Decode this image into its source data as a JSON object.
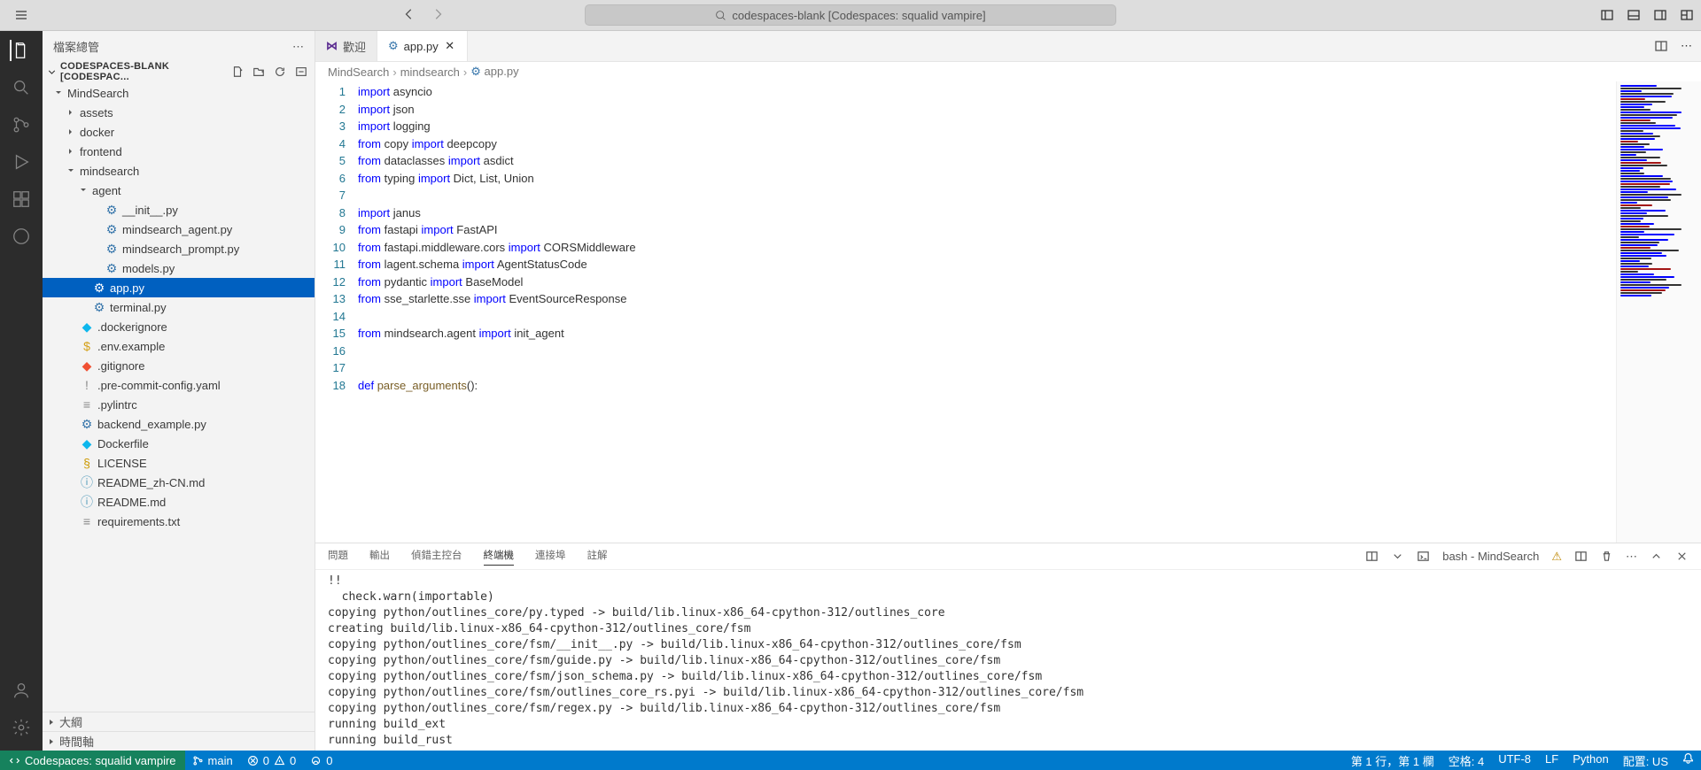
{
  "titlebar": {
    "search_text": "codespaces-blank [Codespaces: squalid vampire]"
  },
  "sidebar": {
    "header": "檔案總管",
    "root": "CODESPACES-BLANK [CODESPAC...",
    "tree": [
      {
        "label": "MindSearch",
        "type": "folder",
        "depth": 0,
        "expanded": true
      },
      {
        "label": "assets",
        "type": "folder",
        "depth": 1,
        "expanded": false
      },
      {
        "label": "docker",
        "type": "folder",
        "depth": 1,
        "expanded": false
      },
      {
        "label": "frontend",
        "type": "folder",
        "depth": 1,
        "expanded": false
      },
      {
        "label": "mindsearch",
        "type": "folder",
        "depth": 1,
        "expanded": true
      },
      {
        "label": "agent",
        "type": "folder",
        "depth": 2,
        "expanded": true
      },
      {
        "label": "__init__.py",
        "type": "python",
        "depth": 3
      },
      {
        "label": "mindsearch_agent.py",
        "type": "python",
        "depth": 3
      },
      {
        "label": "mindsearch_prompt.py",
        "type": "python",
        "depth": 3
      },
      {
        "label": "models.py",
        "type": "python",
        "depth": 3
      },
      {
        "label": "app.py",
        "type": "python",
        "depth": 2,
        "selected": true
      },
      {
        "label": "terminal.py",
        "type": "python",
        "depth": 2
      },
      {
        "label": ".dockerignore",
        "type": "docker",
        "depth": 1
      },
      {
        "label": ".env.example",
        "type": "env",
        "depth": 1
      },
      {
        "label": ".gitignore",
        "type": "git",
        "depth": 1
      },
      {
        "label": ".pre-commit-config.yaml",
        "type": "yaml",
        "depth": 1
      },
      {
        "label": ".pylintrc",
        "type": "text",
        "depth": 1
      },
      {
        "label": "backend_example.py",
        "type": "python",
        "depth": 1
      },
      {
        "label": "Dockerfile",
        "type": "docker",
        "depth": 1
      },
      {
        "label": "LICENSE",
        "type": "license",
        "depth": 1
      },
      {
        "label": "README_zh-CN.md",
        "type": "md",
        "depth": 1
      },
      {
        "label": "README.md",
        "type": "md",
        "depth": 1
      },
      {
        "label": "requirements.txt",
        "type": "text",
        "depth": 1
      }
    ],
    "outline": "大綱",
    "timeline": "時間軸"
  },
  "tabs": [
    {
      "label": "歡迎",
      "icon": "vs",
      "active": false,
      "closable": false
    },
    {
      "label": "app.py",
      "icon": "python",
      "active": true,
      "closable": true
    }
  ],
  "breadcrumb": [
    "MindSearch",
    "mindsearch",
    "app.py"
  ],
  "code": {
    "lines": [
      [
        {
          "t": "import ",
          "c": "kw"
        },
        {
          "t": "asyncio"
        }
      ],
      [
        {
          "t": "import ",
          "c": "kw"
        },
        {
          "t": "json"
        }
      ],
      [
        {
          "t": "import ",
          "c": "kw"
        },
        {
          "t": "logging"
        }
      ],
      [
        {
          "t": "from ",
          "c": "kw"
        },
        {
          "t": "copy "
        },
        {
          "t": "import ",
          "c": "kw"
        },
        {
          "t": "deepcopy"
        }
      ],
      [
        {
          "t": "from ",
          "c": "kw"
        },
        {
          "t": "dataclasses "
        },
        {
          "t": "import ",
          "c": "kw"
        },
        {
          "t": "asdict"
        }
      ],
      [
        {
          "t": "from ",
          "c": "kw"
        },
        {
          "t": "typing "
        },
        {
          "t": "import ",
          "c": "kw"
        },
        {
          "t": "Dict, List, Union"
        }
      ],
      [],
      [
        {
          "t": "import ",
          "c": "kw"
        },
        {
          "t": "janus"
        }
      ],
      [
        {
          "t": "from ",
          "c": "kw"
        },
        {
          "t": "fastapi "
        },
        {
          "t": "import ",
          "c": "kw"
        },
        {
          "t": "FastAPI"
        }
      ],
      [
        {
          "t": "from ",
          "c": "kw"
        },
        {
          "t": "fastapi.middleware.cors "
        },
        {
          "t": "import ",
          "c": "kw"
        },
        {
          "t": "CORSMiddleware"
        }
      ],
      [
        {
          "t": "from ",
          "c": "kw"
        },
        {
          "t": "lagent.schema "
        },
        {
          "t": "import ",
          "c": "kw"
        },
        {
          "t": "AgentStatusCode"
        }
      ],
      [
        {
          "t": "from ",
          "c": "kw"
        },
        {
          "t": "pydantic "
        },
        {
          "t": "import ",
          "c": "kw"
        },
        {
          "t": "BaseModel"
        }
      ],
      [
        {
          "t": "from ",
          "c": "kw"
        },
        {
          "t": "sse_starlette.sse "
        },
        {
          "t": "import ",
          "c": "kw"
        },
        {
          "t": "EventSourceResponse"
        }
      ],
      [],
      [
        {
          "t": "from ",
          "c": "kw"
        },
        {
          "t": "mindsearch.agent "
        },
        {
          "t": "import ",
          "c": "kw"
        },
        {
          "t": "init_agent"
        }
      ],
      [],
      [],
      [
        {
          "t": "def ",
          "c": "kw"
        },
        {
          "t": "parse_arguments",
          "c": "fn"
        },
        {
          "t": "():"
        }
      ]
    ]
  },
  "panel": {
    "tabs": [
      "問題",
      "輸出",
      "偵錯主控台",
      "終端機",
      "連接埠",
      "註解"
    ],
    "active_tab": "終端機",
    "terminal_label": "bash - MindSearch",
    "terminal_lines": [
      "!!",
      "  check.warn(importable)",
      "copying python/outlines_core/py.typed -> build/lib.linux-x86_64-cpython-312/outlines_core",
      "creating build/lib.linux-x86_64-cpython-312/outlines_core/fsm",
      "copying python/outlines_core/fsm/__init__.py -> build/lib.linux-x86_64-cpython-312/outlines_core/fsm",
      "copying python/outlines_core/fsm/guide.py -> build/lib.linux-x86_64-cpython-312/outlines_core/fsm",
      "copying python/outlines_core/fsm/json_schema.py -> build/lib.linux-x86_64-cpython-312/outlines_core/fsm",
      "copying python/outlines_core/fsm/outlines_core_rs.pyi -> build/lib.linux-x86_64-cpython-312/outlines_core/fsm",
      "copying python/outlines_core/fsm/regex.py -> build/lib.linux-x86_64-cpython-312/outlines_core/fsm",
      "running build_ext",
      "running build_rust"
    ]
  },
  "statusbar": {
    "remote": "Codespaces: squalid vampire",
    "branch": "main",
    "errors": "0",
    "warnings": "0",
    "port": "0",
    "cursor": "第 1 行，第 1 欄",
    "spaces": "空格: 4",
    "encoding": "UTF-8",
    "eol": "LF",
    "lang": "Python",
    "layout": "配置: US"
  }
}
